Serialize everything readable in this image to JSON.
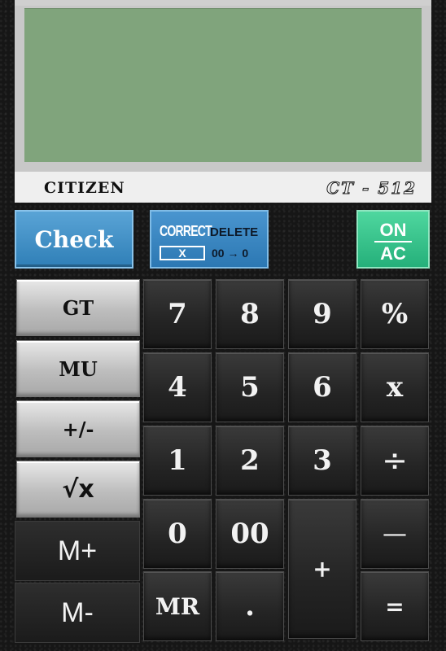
{
  "display": {
    "brand": "CITIZEN",
    "model": "CT - 512"
  },
  "top_buttons": {
    "check": "Check",
    "correct_top": "CORRECT",
    "correct_x": "X",
    "delete_top": "DELETE",
    "delete_bottom": "00 → 0",
    "on": "ON",
    "ac": "AC"
  },
  "function_keys": [
    "GT",
    "MU",
    "+/-",
    "√x"
  ],
  "memory_keys": [
    "M+",
    "M-"
  ],
  "keys": {
    "k7": "7",
    "k8": "8",
    "k9": "9",
    "percent": "%",
    "k4": "4",
    "k5": "5",
    "k6": "6",
    "multiply": "x",
    "k1": "1",
    "k2": "2",
    "k3": "3",
    "divide": "÷",
    "k0": "0",
    "k00": "00",
    "plus": "+",
    "minus": "—",
    "mr": "MR",
    "dot": ".",
    "equals": "="
  },
  "colors": {
    "lcd": "#80a47c",
    "check": "#3d8fc8",
    "onac": "#2fbf85"
  }
}
